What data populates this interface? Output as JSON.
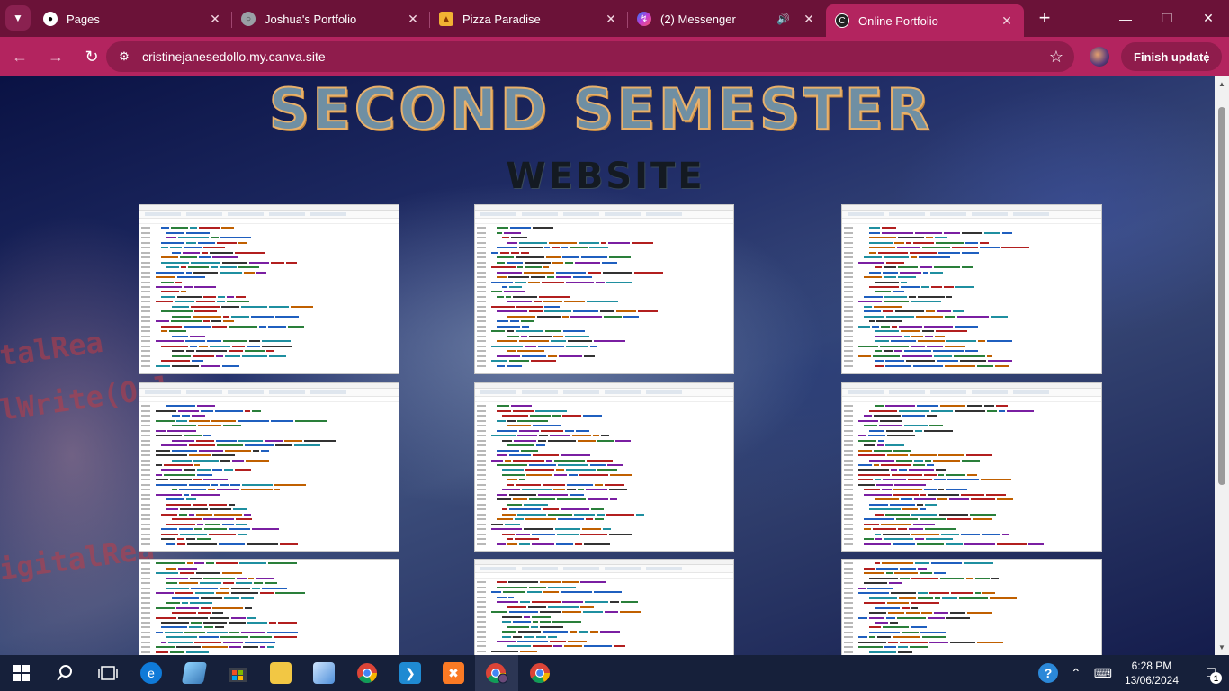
{
  "browser": {
    "tabs": [
      {
        "title": "Pages",
        "icon": "github-icon",
        "active": false
      },
      {
        "title": "Joshua's Portfolio",
        "icon": "globe-icon",
        "active": false
      },
      {
        "title": "Pizza Paradise",
        "icon": "pizza-icon",
        "active": false
      },
      {
        "title": "(2) Messenger",
        "icon": "messenger-icon",
        "active": false,
        "audio": true
      },
      {
        "title": "Online Portfolio",
        "icon": "canva-icon",
        "active": true
      }
    ],
    "url": "cristinejanesedollo.my.canva.site",
    "finish_update_label": "Finish update",
    "colors": {
      "tabstrip": "#6b1238",
      "toolbar": "#b3245f",
      "omnibox": "#8f1c4c"
    }
  },
  "page": {
    "headline": "SECOND SEMESTER",
    "subheadline": "WEBSITE",
    "background_text": [
      "italRea",
      "alWrite(Onl",
      "(digitalRea"
    ]
  },
  "taskbar": {
    "time": "6:28 PM",
    "date": "13/06/2024",
    "notification_count": "1",
    "apps": [
      "start",
      "search",
      "task-view",
      "edge",
      "notes",
      "store",
      "file-explorer",
      "3d-viewer",
      "chrome",
      "vscode",
      "xampp",
      "chrome-profile",
      "chrome"
    ]
  }
}
